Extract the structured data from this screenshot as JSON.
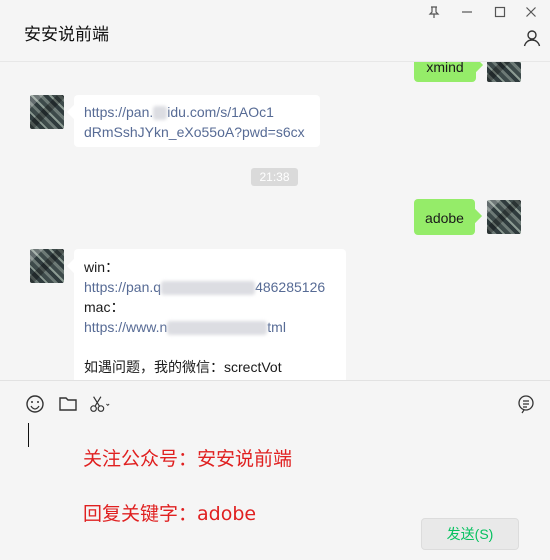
{
  "window": {
    "title": "安安说前端"
  },
  "chat": {
    "messages": [
      {
        "side": "right",
        "text": "xmind"
      },
      {
        "side": "left",
        "lines": [
          "https://pan.",
          "idu.com/s/1AOc1",
          "dRmSshJYkn_eXo55oA?pwd=s6cx"
        ]
      },
      {
        "side": "right",
        "text": "adobe"
      },
      {
        "side": "left",
        "win_label": "win：",
        "win_url_a": "https://pan.q",
        "win_url_b": "486285126",
        "mac_label": "mac：",
        "mac_url_a": "https://www.n",
        "mac_url_b": "tml",
        "note": "如遇问题，我的微信：screctVot"
      }
    ],
    "timestamp": "21:38"
  },
  "input": {
    "promo_line_1": "关注公众号：安安说前端",
    "promo_line_2": "回复关键字：adobe",
    "send_label": "发送(S)"
  },
  "icons": {
    "emoji": "emoji-icon",
    "folder": "folder-icon",
    "scissors": "scissors-icon",
    "chat_history": "chat-history-icon",
    "pin": "pin-icon",
    "minimize": "minimize-icon",
    "maximize": "maximize-icon",
    "close": "close-icon",
    "profile": "profile-icon"
  },
  "colors": {
    "bubble_self": "#95ec69",
    "link": "#576b95",
    "promo": "#e02020",
    "send_text": "#07c160"
  }
}
